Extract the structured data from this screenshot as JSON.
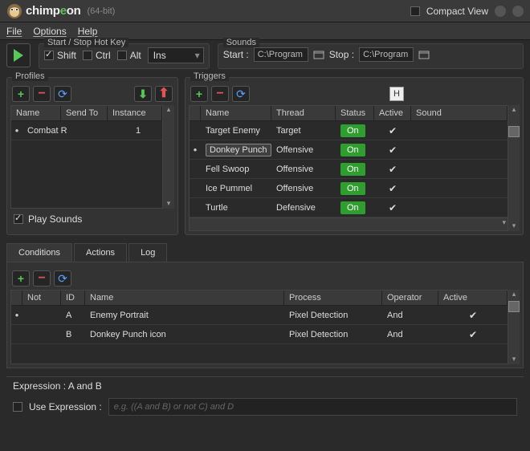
{
  "titlebar": {
    "brand_pre": "chimp",
    "brand_e": "e",
    "brand_post": "on",
    "bit": "(64-bit)",
    "compact": "Compact View"
  },
  "menu": {
    "file": "File",
    "options": "Options",
    "help": "Help"
  },
  "hotkey": {
    "title": "Start / Stop Hot Key",
    "shift": "Shift",
    "ctrl": "Ctrl",
    "alt": "Alt",
    "ins": "Ins"
  },
  "sounds": {
    "title": "Sounds",
    "start": "Start :",
    "stop": "Stop :",
    "path": "C:\\Program"
  },
  "profiles": {
    "title": "Profiles",
    "cols": {
      "name": "Name",
      "sendto": "Send To",
      "instance": "Instance"
    },
    "rows": [
      {
        "name": "Combat Ro",
        "sendto": "",
        "instance": "1"
      }
    ],
    "play_sounds": "Play Sounds"
  },
  "triggers": {
    "title": "Triggers",
    "h_char": "H",
    "cols": {
      "name": "Name",
      "thread": "Thread",
      "status": "Status",
      "active": "Active",
      "sound": "Sound"
    },
    "rows": [
      {
        "name": "Target Enemy",
        "thread": "Target",
        "status": "On",
        "active": true,
        "selected": false,
        "current": false
      },
      {
        "name": "Donkey Punch",
        "thread": "Offensive",
        "status": "On",
        "active": true,
        "selected": true,
        "current": true
      },
      {
        "name": "Fell Swoop",
        "thread": "Offensive",
        "status": "On",
        "active": true,
        "selected": false,
        "current": false
      },
      {
        "name": "Ice Pummel",
        "thread": "Offensive",
        "status": "On",
        "active": true,
        "selected": false,
        "current": false
      },
      {
        "name": "Turtle",
        "thread": "Defensive",
        "status": "On",
        "active": true,
        "selected": false,
        "current": false
      }
    ]
  },
  "tabs": {
    "conditions": "Conditions",
    "actions": "Actions",
    "log": "Log"
  },
  "conditions": {
    "cols": {
      "not": "Not",
      "id": "ID",
      "name": "Name",
      "process": "Process",
      "operator": "Operator",
      "active": "Active"
    },
    "rows": [
      {
        "id": "A",
        "name": "Enemy Portrait",
        "process": "Pixel Detection",
        "operator": "And",
        "active": true,
        "current": true
      },
      {
        "id": "B",
        "name": "Donkey Punch icon",
        "process": "Pixel Detection",
        "operator": "And",
        "active": true,
        "current": false
      }
    ]
  },
  "expr": {
    "label": "Expression :",
    "value": "A and B",
    "use": "Use Expression :",
    "placeholder": "e.g. ((A and B) or not C) and D"
  }
}
